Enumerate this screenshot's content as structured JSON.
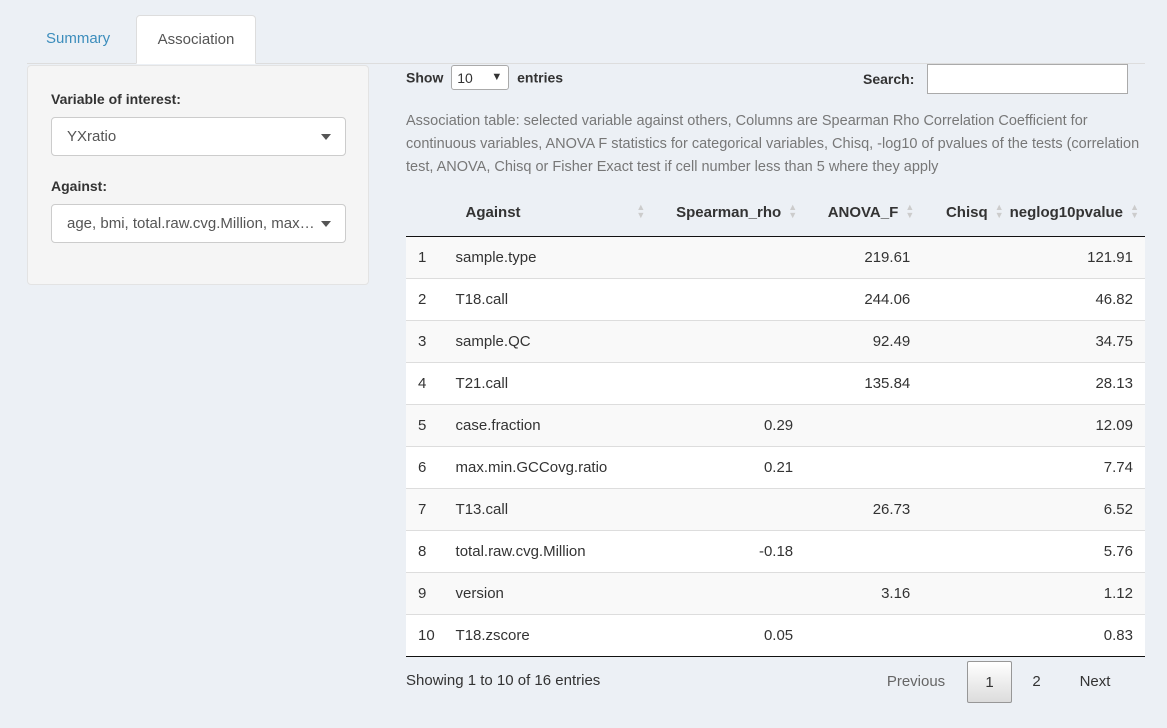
{
  "tabs": [
    {
      "label": "Summary"
    },
    {
      "label": "Association"
    }
  ],
  "sidebar": {
    "variable_label": "Variable of interest:",
    "variable_value": "YXratio",
    "against_label": "Against:",
    "against_value": "age, bmi, total.raw.cvg.Million, max.min.GCCovg.ratio"
  },
  "controls": {
    "show": "Show",
    "length_value": "10",
    "entries": "entries",
    "search_label": "Search:",
    "search_value": ""
  },
  "caption": "Association table: selected variable against others, Columns are Spearman Rho Correlation Coefficient for continuous variables, ANOVA F statistics for categorical variables, Chisq, -log10 of pvalues of the tests (correlation test, ANOVA, Chisq or Fisher Exact test if cell number less than 5 where they apply",
  "table": {
    "headers": [
      "",
      "Against",
      "Spearman_rho",
      "ANOVA_F",
      "Chisq",
      "neglog10pvalue"
    ],
    "rows": [
      [
        "1",
        "sample.type",
        "",
        "219.61",
        "",
        "121.91"
      ],
      [
        "2",
        "T18.call",
        "",
        "244.06",
        "",
        "46.82"
      ],
      [
        "3",
        "sample.QC",
        "",
        "92.49",
        "",
        "34.75"
      ],
      [
        "4",
        "T21.call",
        "",
        "135.84",
        "",
        "28.13"
      ],
      [
        "5",
        "case.fraction",
        "0.29",
        "",
        "",
        "12.09"
      ],
      [
        "6",
        "max.min.GCCovg.ratio",
        "0.21",
        "",
        "",
        "7.74"
      ],
      [
        "7",
        "T13.call",
        "",
        "26.73",
        "",
        "6.52"
      ],
      [
        "8",
        "total.raw.cvg.Million",
        "-0.18",
        "",
        "",
        "5.76"
      ],
      [
        "9",
        "version",
        "",
        "3.16",
        "",
        "1.12"
      ],
      [
        "10",
        "T18.zscore",
        "0.05",
        "",
        "",
        "0.83"
      ]
    ]
  },
  "footer": {
    "info": "Showing 1 to 10 of 16 entries",
    "previous": "Previous",
    "page1": "1",
    "page2": "2",
    "next": "Next"
  }
}
